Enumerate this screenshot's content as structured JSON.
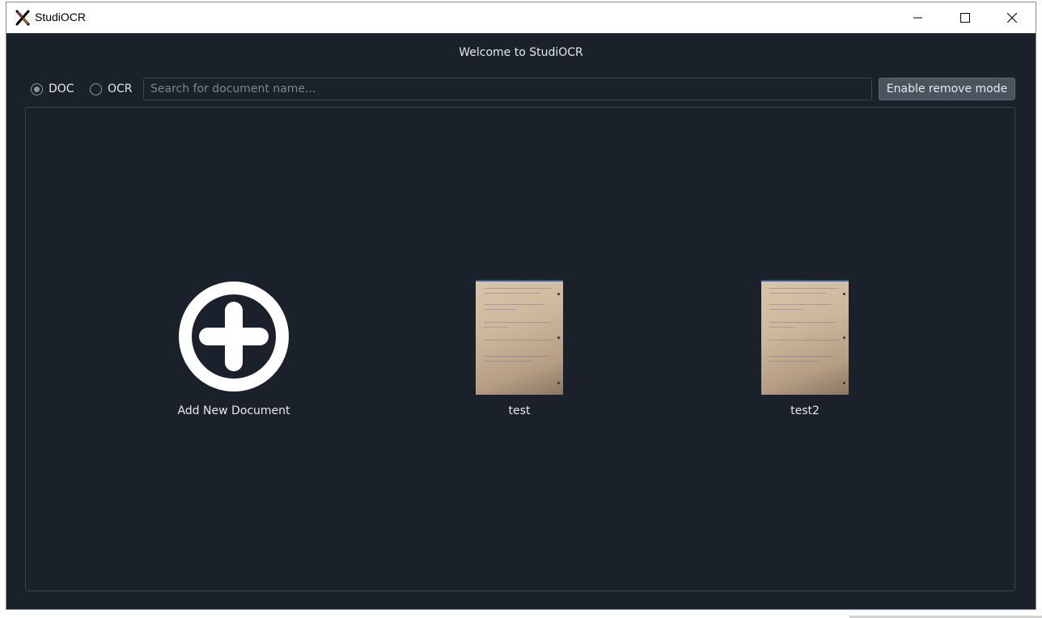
{
  "window": {
    "title": "StudiOCR"
  },
  "header": {
    "welcome_text": "Welcome to StudiOCR"
  },
  "toolbar": {
    "mode_options": [
      {
        "label": "DOC",
        "selected": true
      },
      {
        "label": "OCR",
        "selected": false
      }
    ],
    "search_placeholder": "Search for document name...",
    "search_value": "",
    "remove_mode_label": "Enable remove mode"
  },
  "documents": {
    "add_label": "Add New Document",
    "items": [
      {
        "name": "test",
        "thumbnail_icon": "scanned-page-thumbnail"
      },
      {
        "name": "test2",
        "thumbnail_icon": "scanned-page-thumbnail"
      }
    ]
  },
  "theme": {
    "background": "#1a212b",
    "text": "#e6e9ed",
    "button_bg": "#4a545f"
  }
}
